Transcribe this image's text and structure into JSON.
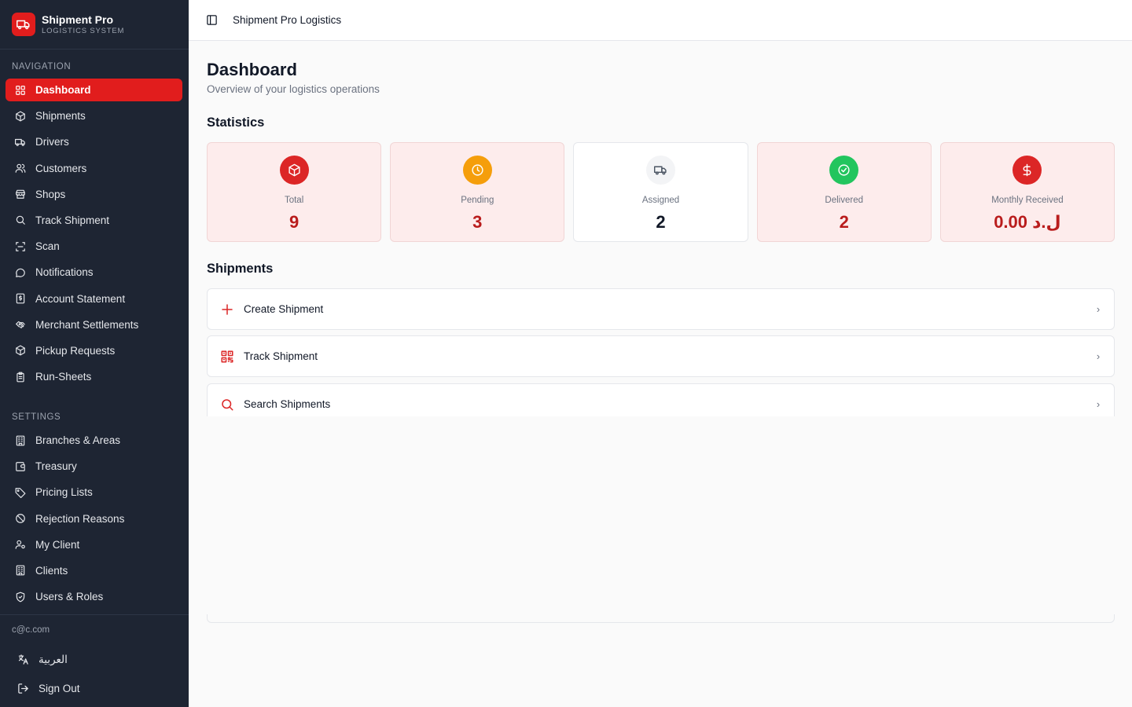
{
  "brand": {
    "name": "Shipment Pro",
    "subtitle": "LOGISTICS SYSTEM",
    "logo_icon": "truck-icon",
    "logo_color": "#e11d1d"
  },
  "sidebar": {
    "navigation_label": "NAVIGATION",
    "navigation": [
      {
        "label": "Dashboard",
        "icon": "grid-icon",
        "active": true
      },
      {
        "label": "Shipments",
        "icon": "package-icon"
      },
      {
        "label": "Drivers",
        "icon": "truck-icon"
      },
      {
        "label": "Customers",
        "icon": "users-icon"
      },
      {
        "label": "Shops",
        "icon": "store-icon"
      },
      {
        "label": "Track Shipment",
        "icon": "search-icon"
      },
      {
        "label": "Scan",
        "icon": "scan-icon"
      },
      {
        "label": "Notifications",
        "icon": "message-icon"
      },
      {
        "label": "Account Statement",
        "icon": "receipt-icon"
      },
      {
        "label": "Merchant Settlements",
        "icon": "handshake-icon"
      },
      {
        "label": "Pickup Requests",
        "icon": "package-icon"
      },
      {
        "label": "Run-Sheets",
        "icon": "clipboard-icon"
      }
    ],
    "settings_label": "SETTINGS",
    "settings": [
      {
        "label": "Branches & Areas",
        "icon": "building-icon"
      },
      {
        "label": "Treasury",
        "icon": "wallet-icon"
      },
      {
        "label": "Pricing Lists",
        "icon": "tag-icon"
      },
      {
        "label": "Rejection Reasons",
        "icon": "ban-icon"
      },
      {
        "label": "My Client",
        "icon": "user-cog-icon"
      },
      {
        "label": "Clients",
        "icon": "building-icon"
      },
      {
        "label": "Users & Roles",
        "icon": "shield-icon"
      }
    ],
    "footer": {
      "email": "c@c.com",
      "language_label": "العربية",
      "sign_out_label": "Sign Out"
    }
  },
  "topbar": {
    "title": "Shipment Pro Logistics",
    "toggle_icon": "panel-left-icon"
  },
  "page": {
    "title": "Dashboard",
    "subtitle": "Overview of your logistics operations"
  },
  "statistics": {
    "heading": "Statistics",
    "cards": [
      {
        "label": "Total",
        "value": "9",
        "icon": "package-icon",
        "icon_color": "#dc2626"
      },
      {
        "label": "Pending",
        "value": "3",
        "icon": "clock-icon",
        "icon_color": "#f59e0b"
      },
      {
        "label": "Assigned",
        "value": "2",
        "icon": "truck-icon",
        "icon_color": "#f3f4f6"
      },
      {
        "label": "Delivered",
        "value": "2",
        "icon": "check-circle-icon",
        "icon_color": "#22c55e"
      },
      {
        "label": "Monthly Received",
        "value": "0.00 ل.د",
        "icon": "dollar-icon",
        "icon_color": "#dc2626"
      }
    ]
  },
  "shipments": {
    "heading": "Shipments",
    "actions": [
      {
        "label": "Create Shipment",
        "icon": "plus-icon"
      },
      {
        "label": "Track Shipment",
        "icon": "qr-code-icon"
      },
      {
        "label": "Search Shipments",
        "icon": "search-icon"
      }
    ],
    "chevron": "›"
  }
}
